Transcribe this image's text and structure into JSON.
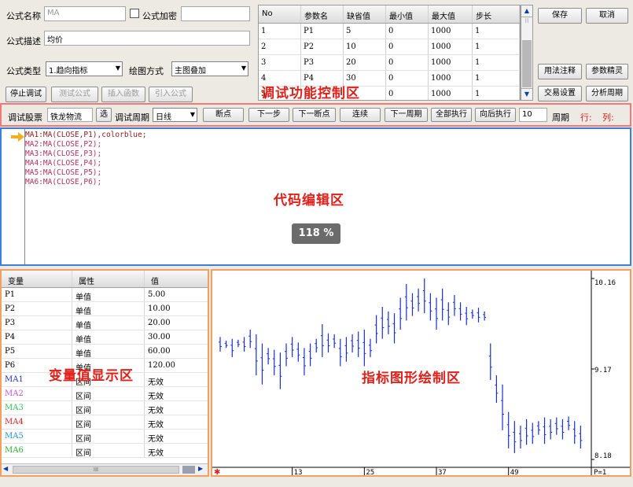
{
  "formula": {
    "name_label": "公式名称",
    "name_value": "MA",
    "encrypt_label": "公式加密",
    "desc_label": "公式描述",
    "desc_value": "均价",
    "type_label": "公式类型",
    "type_value": "1.趋向指标",
    "draw_label": "绘图方式",
    "draw_value": "主图叠加"
  },
  "left_buttons": {
    "stop_debug": "停止调试",
    "test_formula": "测试公式",
    "insert_func": "插入函数",
    "import_formula": "引入公式"
  },
  "right_buttons": {
    "save": "保存",
    "cancel": "取消",
    "usage": "用法注释",
    "param_tips": "参数精灵",
    "trade_settings": "交易设置",
    "analyze_period": "分析周期"
  },
  "param_table": {
    "headers": [
      "No",
      "参数名",
      "缺省值",
      "最小值",
      "最大值",
      "步长"
    ],
    "rows": [
      [
        "1",
        "P1",
        "5",
        "0",
        "1000",
        "1"
      ],
      [
        "2",
        "P2",
        "10",
        "0",
        "1000",
        "1"
      ],
      [
        "3",
        "P3",
        "20",
        "0",
        "1000",
        "1"
      ],
      [
        "4",
        "P4",
        "30",
        "0",
        "1000",
        "1"
      ],
      [
        "5",
        "",
        "",
        "0",
        "1000",
        "1"
      ]
    ]
  },
  "debug": {
    "stock_label": "调试股票",
    "stock_value": "铁龙物流",
    "select_btn": "选",
    "period_label": "调试周期",
    "period_value": "日线",
    "breakpoint": "断点",
    "step": "下一步",
    "next_breakpoint": "下一断点",
    "continue": "连续",
    "next_period": "下一周期",
    "run_all": "全部执行",
    "run_back": "向后执行",
    "period_count": "10",
    "period_unit": "周期",
    "row_label": "行:",
    "col_label": "列:"
  },
  "code_lines": [
    {
      "text": "MA1:MA(CLOSE,P1),colorblue;",
      "color": "#8b1a1a"
    },
    {
      "text": "MA2:MA(CLOSE,P2);",
      "color": "#b03060"
    },
    {
      "text": "MA3:MA(CLOSE,P3);",
      "color": "#b03060"
    },
    {
      "text": "MA4:MA(CLOSE,P4);",
      "color": "#b03060"
    },
    {
      "text": "MA5:MA(CLOSE,P5);",
      "color": "#b03060"
    },
    {
      "text": "MA6:MA(CLOSE,P6);",
      "color": "#b03060"
    }
  ],
  "zoom": "118 %",
  "var_table": {
    "headers": [
      "变量",
      "属性",
      "值"
    ],
    "rows": [
      {
        "name": "P1",
        "attr": "单值",
        "value": "5.00",
        "color": "#000000"
      },
      {
        "name": "P2",
        "attr": "单值",
        "value": "10.00",
        "color": "#000000"
      },
      {
        "name": "P3",
        "attr": "单值",
        "value": "20.00",
        "color": "#000000"
      },
      {
        "name": "P4",
        "attr": "单值",
        "value": "30.00",
        "color": "#000000"
      },
      {
        "name": "P5",
        "attr": "单值",
        "value": "60.00",
        "color": "#000000"
      },
      {
        "name": "P6",
        "attr": "单值",
        "value": "120.00",
        "color": "#000000"
      },
      {
        "name": "MA1",
        "attr": "区间",
        "value": "无效",
        "color": "#2030d0"
      },
      {
        "name": "MA2",
        "attr": "区间",
        "value": "无效",
        "color": "#d050d0"
      },
      {
        "name": "MA3",
        "attr": "区间",
        "value": "无效",
        "color": "#30c060"
      },
      {
        "name": "MA4",
        "attr": "区间",
        "value": "无效",
        "color": "#e02020"
      },
      {
        "name": "MA5",
        "attr": "区间",
        "value": "无效",
        "color": "#2090e0"
      },
      {
        "name": "MA6",
        "attr": "区间",
        "value": "无效",
        "color": "#30b030"
      }
    ],
    "scroll_grip": "III"
  },
  "overlays": {
    "debug_area": "调试功能控制区",
    "code_area": "代码编辑区",
    "var_area": "变量值显示区",
    "chart_area": "指标图形绘制区"
  },
  "chart": {
    "y_labels": [
      "10.16",
      "9.17",
      "8.18"
    ],
    "x_labels": [
      "13",
      "25",
      "37",
      "49"
    ],
    "corner_label": "P=1",
    "bar_color": "#1a2fd0",
    "ohlc": [
      {
        "h": 9.52,
        "l": 9.36
      },
      {
        "h": 9.48,
        "l": 9.4
      },
      {
        "h": 9.5,
        "l": 9.3
      },
      {
        "h": 9.49,
        "l": 9.41
      },
      {
        "h": 9.52,
        "l": 9.36
      },
      {
        "h": 9.6,
        "l": 9.4
      },
      {
        "h": 9.55,
        "l": 9.1
      },
      {
        "h": 9.45,
        "l": 9.0
      },
      {
        "h": 9.4,
        "l": 9.22
      },
      {
        "h": 9.38,
        "l": 9.1
      },
      {
        "h": 9.35,
        "l": 8.95
      },
      {
        "h": 9.45,
        "l": 9.2
      },
      {
        "h": 9.52,
        "l": 9.3
      },
      {
        "h": 9.46,
        "l": 9.25
      },
      {
        "h": 9.4,
        "l": 9.1
      },
      {
        "h": 9.45,
        "l": 9.2
      },
      {
        "h": 9.5,
        "l": 9.35
      },
      {
        "h": 9.66,
        "l": 9.3
      },
      {
        "h": 9.56,
        "l": 9.35
      },
      {
        "h": 9.55,
        "l": 9.4
      },
      {
        "h": 9.5,
        "l": 9.2
      },
      {
        "h": 9.52,
        "l": 9.25
      },
      {
        "h": 9.55,
        "l": 9.35
      },
      {
        "h": 9.58,
        "l": 9.3
      },
      {
        "h": 9.6,
        "l": 9.2
      },
      {
        "h": 9.5,
        "l": 9.3
      },
      {
        "h": 9.76,
        "l": 9.45
      },
      {
        "h": 9.85,
        "l": 9.5
      },
      {
        "h": 9.8,
        "l": 9.55
      },
      {
        "h": 9.78,
        "l": 9.45
      },
      {
        "h": 9.95,
        "l": 9.6
      },
      {
        "h": 10.1,
        "l": 9.7
      },
      {
        "h": 10.0,
        "l": 9.75
      },
      {
        "h": 10.05,
        "l": 9.8
      },
      {
        "h": 10.16,
        "l": 9.78
      },
      {
        "h": 10.0,
        "l": 9.7
      },
      {
        "h": 9.95,
        "l": 9.6
      },
      {
        "h": 10.05,
        "l": 9.7
      },
      {
        "h": 9.9,
        "l": 9.65
      },
      {
        "h": 9.98,
        "l": 9.75
      },
      {
        "h": 9.9,
        "l": 9.7
      },
      {
        "h": 9.85,
        "l": 9.65
      },
      {
        "h": 9.82,
        "l": 9.72
      },
      {
        "h": 9.84,
        "l": 9.68
      },
      {
        "h": 9.8,
        "l": 9.7
      },
      {
        "h": 9.45,
        "l": 9.05
      },
      {
        "h": 9.1,
        "l": 8.8
      },
      {
        "h": 9.0,
        "l": 8.5
      },
      {
        "h": 8.7,
        "l": 8.3
      },
      {
        "h": 8.6,
        "l": 8.25
      },
      {
        "h": 8.55,
        "l": 8.3
      },
      {
        "h": 8.62,
        "l": 8.34
      },
      {
        "h": 8.58,
        "l": 8.35
      },
      {
        "h": 8.6,
        "l": 8.45
      },
      {
        "h": 8.64,
        "l": 8.35
      },
      {
        "h": 8.62,
        "l": 8.4
      },
      {
        "h": 8.64,
        "l": 8.45
      },
      {
        "h": 8.62,
        "l": 8.4
      },
      {
        "h": 8.65,
        "l": 8.5
      },
      {
        "h": 8.6,
        "l": 8.35
      },
      {
        "h": 8.55,
        "l": 8.3
      }
    ],
    "y_range": [
      8.18,
      10.16
    ]
  }
}
